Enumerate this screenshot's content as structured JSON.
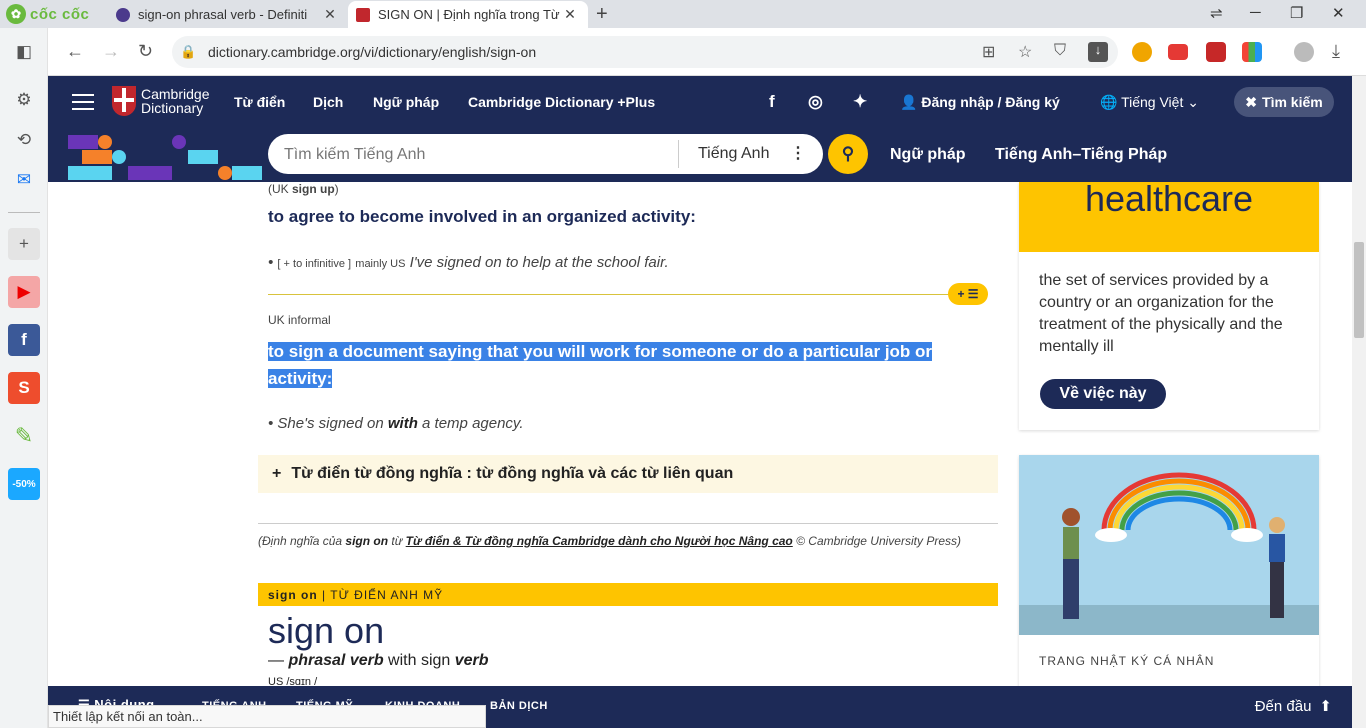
{
  "browser": {
    "brand": "cốc cốc",
    "tabs": [
      {
        "title": "sign-on phrasal verb - Definiti",
        "close": "✕"
      },
      {
        "title": "SIGN ON | Định nghĩa trong Từ",
        "close": "✕"
      }
    ],
    "new_tab": "+",
    "url": "dictionary.cambridge.org/vi/dictionary/english/sign-on",
    "status": "Thiết lập kết nối an toàn..."
  },
  "header": {
    "logo_line1": "Cambridge",
    "logo_line2": "Dictionary",
    "nav": [
      "Từ điển",
      "Dịch",
      "Ngữ pháp",
      "Cambridge Dictionary +Plus"
    ],
    "login": "Đăng nhập / Đăng ký",
    "language": "Tiếng Việt",
    "search_toggle": "Tìm kiếm"
  },
  "search": {
    "placeholder": "Tìm kiếm Tiếng Anh",
    "dictionary": "Tiếng Anh",
    "links": [
      "Ngữ pháp",
      "Tiếng Anh–Tiếng Pháp"
    ]
  },
  "entry": {
    "uk_signup_pre": "(UK ",
    "uk_signup_word": "sign up",
    "uk_signup_post": ")",
    "def1": "to agree to become involved in an organized activity:",
    "ex1_gram": "[ + to infinitive ]",
    "ex1_usage": "mainly US",
    "ex1": "I've signed on to help at the school fair.",
    "label2": "UK informal",
    "def2": "to sign a document saying that you will work for someone or do a particular job or activity:",
    "ex2_a": "She's signed on ",
    "ex2_b": "with",
    "ex2_c": " a temp agency.",
    "thesaurus": "Từ điển từ đồng nghĩa : từ đồng nghĩa và các từ liên quan",
    "source_pre": "(Định nghĩa của ",
    "source_word": "sign on",
    "source_mid": " từ ",
    "source_link": "Từ điển & Từ đồng nghĩa Cambridge dành cho Người học Nâng cao",
    "source_post": " © Cambridge University Press)",
    "us_bar_word": "sign on",
    "us_bar_label": "| TỪ ĐIỂN ANH MỸ",
    "headword": "sign on",
    "pos_pre": "— ",
    "pos": "phrasal verb",
    "pos_mid": " with sign ",
    "pos_verb": "verb",
    "pron": "US  /sɑɪn /"
  },
  "sidebar": {
    "wotd": "healthcare",
    "wotd_def": "the set of services provided by a country or an organization for the treatment of the physically and the mentally ill",
    "about": "Về việc này",
    "blog_label": "TRANG NHẬT KÝ CÁ NHÂN"
  },
  "bottom": {
    "items": [
      "Nội dung",
      "TIẾNG ANH",
      "TIẾNG MỸ",
      "KINH DOANH",
      "BẢN DỊCH"
    ],
    "back_top": "Đến đầu"
  }
}
